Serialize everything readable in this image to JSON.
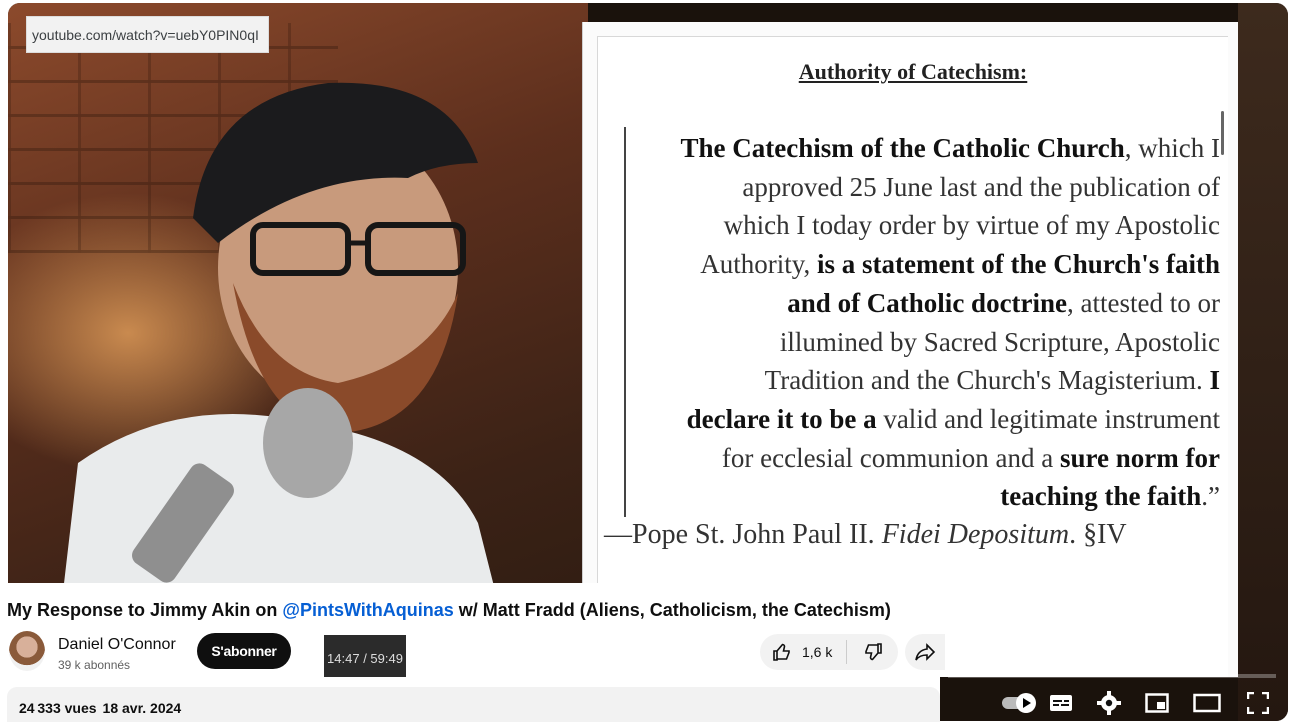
{
  "tooltip": {
    "url": "youtube.com/watch?v=uebY0PIN0qI"
  },
  "document": {
    "heading": "Authority of Catechism:",
    "quote": [
      [
        {
          "t": "The Catechism of the Catholic Church",
          "b": true
        },
        {
          "t": ", which I",
          "b": false
        }
      ],
      [
        {
          "t": "approved 25 June last and the publication of",
          "b": false
        }
      ],
      [
        {
          "t": "which I today order by virtue of my Apostolic",
          "b": false
        }
      ],
      [
        {
          "t": "Authority, ",
          "b": false
        },
        {
          "t": "is a statement of the Church's faith",
          "b": true
        }
      ],
      [
        {
          "t": "and of Catholic doctrine",
          "b": true
        },
        {
          "t": ", attested to or",
          "b": false
        }
      ],
      [
        {
          "t": "illumined by Sacred Scripture, Apostolic",
          "b": false
        }
      ],
      [
        {
          "t": "Tradition and the Church's Magisterium. ",
          "b": false
        },
        {
          "t": "I",
          "b": true
        }
      ],
      [
        {
          "t": "declare it to be a",
          "b": true
        },
        {
          "t": " valid and legitimate instrument",
          "b": false
        }
      ],
      [
        {
          "t": "for ecclesial communion and a ",
          "b": false
        },
        {
          "t": "sure norm for",
          "b": true
        }
      ],
      [
        {
          "t": "teaching the faith",
          "b": true
        },
        {
          "t": ".”",
          "b": false
        }
      ]
    ],
    "attribution_prefix": "—Pope St. John Paul II. ",
    "attribution_work": "Fidei Depositum",
    "attribution_suffix": ". §IV"
  },
  "video": {
    "title_before": "My Response to Jimmy Akin on ",
    "title_mention": "@PintsWithAquinas",
    "title_after": " w/ Matt Fradd (Aliens, Catholicism, the Catechism)",
    "time": "14:47 / 59:49"
  },
  "channel": {
    "name": "Daniel O'Connor",
    "subscribers": "39 k abonnés",
    "subscribe_label": "S'abonner"
  },
  "actions": {
    "likes": "1,6 k"
  },
  "meta": {
    "views": "24 333 vues",
    "date": "18 avr. 2024"
  },
  "icons": [
    "autoplay-toggle-icon",
    "subtitles-icon",
    "settings-icon",
    "miniplayer-icon",
    "theater-icon",
    "fullscreen-icon",
    "like-icon",
    "dislike-icon",
    "share-icon"
  ]
}
